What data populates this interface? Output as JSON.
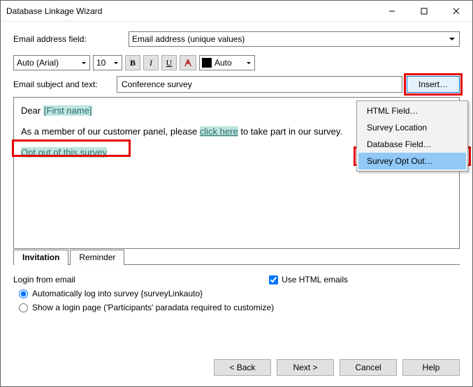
{
  "title": "Database Linkage Wizard",
  "emailFieldLabel": "Email address field:",
  "emailFieldValue": "Email address (unique values)",
  "toolbar": {
    "font": "Auto (Arial)",
    "size": "10",
    "bold": "B",
    "italic": "I",
    "underline": "U",
    "autoColor": "Auto"
  },
  "subjectLabel": "Email subject and text:",
  "subjectValue": "Conference survey",
  "insertLabel": "Insert…",
  "editor": {
    "dear": "Dear ",
    "firstName": "[First name]",
    "body1": "As a member of our customer panel, please ",
    "clickHere": "click here",
    "body2": " to take part in our survey.",
    "optOut": "Opt out of this survey"
  },
  "tabs": {
    "invitation": "Invitation",
    "reminder": "Reminder"
  },
  "opts": {
    "loginHeader": "Login from email",
    "useHtml": "Use HTML emails",
    "autoLogin": "Automatically log into survey {surveyLinkauto}",
    "loginPage": "Show a login page ('Participants' paradata required to customize)"
  },
  "footer": {
    "back": "< Back",
    "next": "Next >",
    "cancel": "Cancel",
    "help": "Help"
  },
  "menu": {
    "htmlField": "HTML Field…",
    "surveyLoc": "Survey Location",
    "dbField": "Database Field…",
    "optOut": "Survey Opt Out…"
  }
}
